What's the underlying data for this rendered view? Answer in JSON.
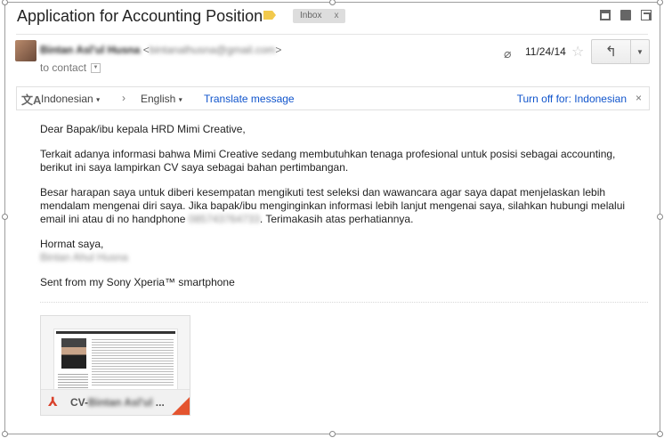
{
  "header": {
    "subject": "Application for Accounting Position",
    "inbox_label": "Inbox",
    "inbox_remove": "x"
  },
  "sender": {
    "name": "Bintan Asl'ul Husna",
    "email_prefix": "<",
    "email": "bintanalhusna@gmail.com",
    "email_suffix": ">",
    "to": "to contact",
    "dropdown": "▼"
  },
  "meta": {
    "date": "11/24/14",
    "attach_icon": "⌀",
    "star": "☆",
    "reply_icon": "↰",
    "more_icon": "▼"
  },
  "translate": {
    "icon": "文A",
    "from_lang": "Indonesian",
    "caret": "▾",
    "arrow": "›",
    "to_lang": "English",
    "translate_link": "Translate message",
    "turn_off": "Turn off for: Indonesian",
    "close": "×"
  },
  "message": {
    "greeting": "Dear Bapak/ibu kepala HRD Mimi Creative,",
    "para1": "Terkait adanya informasi bahwa Mimi Creative sedang membutuhkan tenaga profesional untuk posisi sebagai accounting, berikut ini saya lampirkan CV saya sebagai bahan pertimbangan.",
    "para2_a": "Besar harapan saya untuk diberi kesempatan mengikuti test seleksi dan wawancara agar saya dapat menjelaskan lebih mendalam mengenai diri saya. Jika bapak/ibu menginginkan informasi lebih lanjut mengenai saya, silahkan hubungi melalui email ini atau di no handphone ",
    "phone": "085743764733",
    "para2_b": ". Terimakasih atas perhatiannya.",
    "closing": "Hormat saya,",
    "signature_name": "Bintan Ahul Husna",
    "sent_from": "Sent from my Sony Xperia™ smartphone"
  },
  "attachment": {
    "pdf_icon": "⅄",
    "name_visible": "CV-",
    "name_blurred": "Bintan Asl'ul",
    "ellipsis": "..."
  }
}
